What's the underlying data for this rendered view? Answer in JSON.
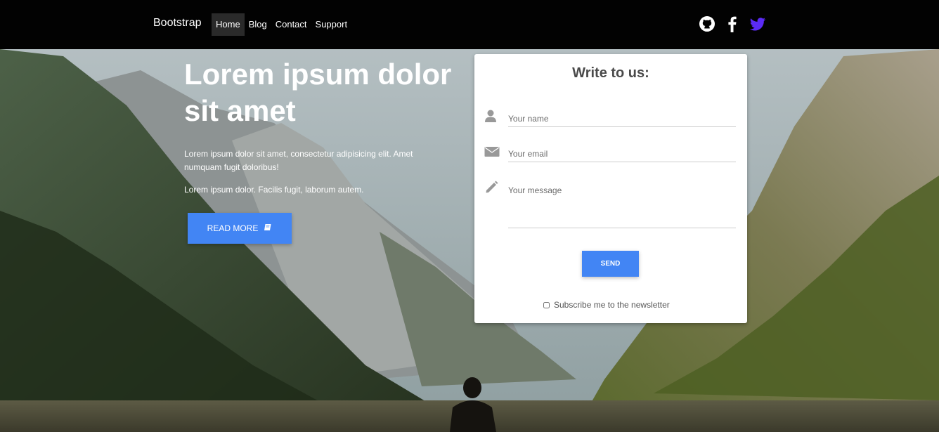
{
  "navbar": {
    "brand": "Bootstrap",
    "links": [
      {
        "label": "Home",
        "active": true
      },
      {
        "label": "Blog",
        "active": false
      },
      {
        "label": "Contact",
        "active": false
      },
      {
        "label": "Support",
        "active": false
      }
    ],
    "social_icons": [
      "github-icon",
      "facebook-icon",
      "twitter-icon"
    ],
    "twitter_color": "#5b2bf5"
  },
  "hero": {
    "title": "Lorem ipsum dolor sit amet",
    "paragraph1": "Lorem ipsum dolor sit amet, consectetur adipisicing elit. Amet numquam fugit doloribus!",
    "paragraph2": "Lorem ipsum dolor. Facilis fugit, laborum autem.",
    "read_more_label": "READ MORE",
    "read_more_icon": "book-icon"
  },
  "contact": {
    "title": "Write to us:",
    "name_placeholder": "Your name",
    "email_placeholder": "Your email",
    "message_placeholder": "Your message",
    "send_label": "SEND",
    "newsletter_label": "Subscribe me to the newsletter",
    "icons": [
      "user-icon",
      "envelope-icon",
      "pencil-icon"
    ]
  },
  "colors": {
    "accent": "#4285f4",
    "navbar_bg": "#020202"
  }
}
